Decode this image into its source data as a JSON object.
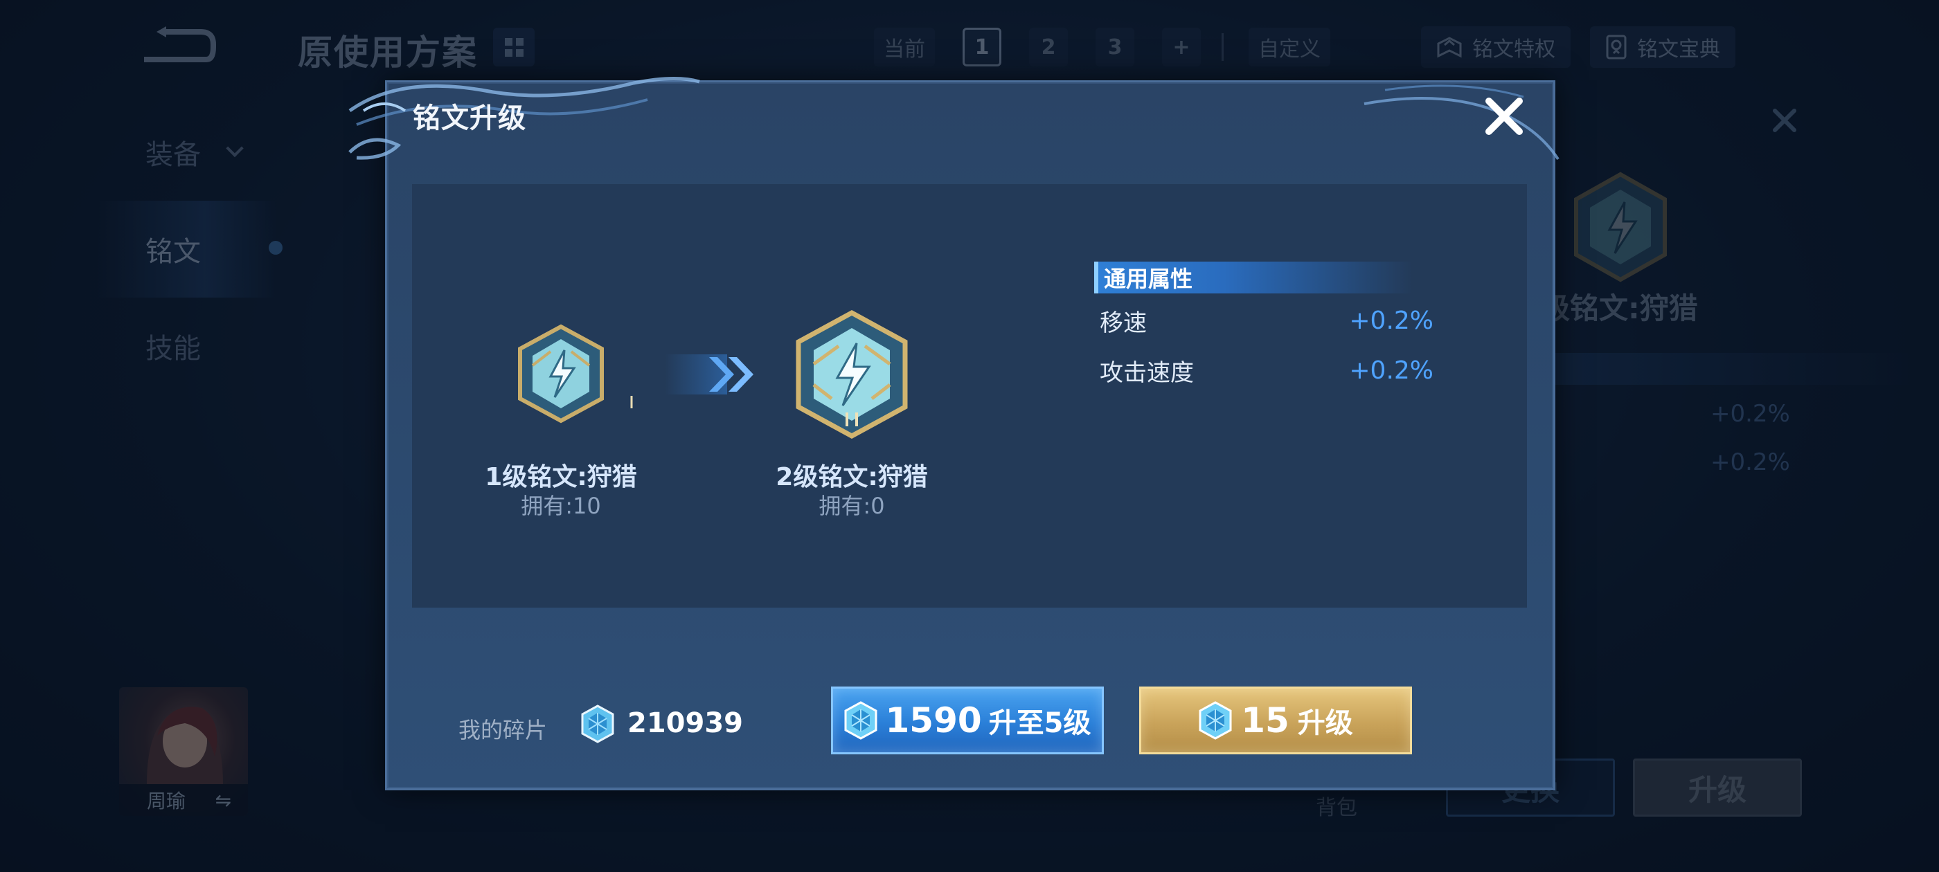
{
  "background": {
    "plan_title": "原使用方案",
    "tabs": {
      "current_label": "当前",
      "plans": [
        "1",
        "2",
        "3"
      ],
      "active_plan": "1",
      "add_label": "+",
      "custom_label": "自定义"
    },
    "privilege_label": "铭文特权",
    "codex_label": "铭文宝典",
    "side_menu": [
      {
        "label": "装备"
      },
      {
        "label": "铭文"
      },
      {
        "label": "技能"
      }
    ],
    "hero_name": "周瑜",
    "swap_glyph": "⇋",
    "bag_label": "背包",
    "right_panel": {
      "title": "级铭文:狩猎",
      "values": [
        "+0.2%",
        "+0.2%"
      ],
      "change_button": "更换",
      "upgrade_button": "升级"
    }
  },
  "modal": {
    "title": "铭文升级",
    "from": {
      "name": "1级铭文:狩猎",
      "owned": "拥有:10",
      "numeral": "I"
    },
    "to": {
      "name": "2级铭文:狩猎",
      "owned": "拥有:0",
      "numeral": "II"
    },
    "attributes_header": "通用属性",
    "attributes": [
      {
        "name": "移速",
        "value": "+0.2%"
      },
      {
        "name": "攻击速度",
        "value": "+0.2%"
      }
    ],
    "fragments_label": "我的碎片",
    "fragments_count": "210939",
    "buttons": {
      "upgrade_max_cost": "1590",
      "upgrade_max_label": "升至5级",
      "upgrade_cost": "15",
      "upgrade_label": "升级"
    }
  },
  "colors": {
    "accent_blue": "#4fa3ff",
    "gold_button": "#c9a35a",
    "modal_bg": "#2c4a6f"
  }
}
